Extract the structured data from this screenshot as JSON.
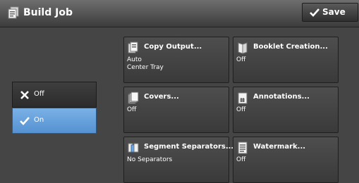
{
  "header": {
    "title": "Build Job",
    "save_label": "Save"
  },
  "toggle": {
    "off_label": "Off",
    "on_label": "On",
    "selected": "On"
  },
  "tiles": [
    {
      "title": "Copy Output...",
      "value": "Auto\nCenter Tray"
    },
    {
      "title": "Booklet Creation...",
      "value": "Off"
    },
    {
      "title": "Covers...",
      "value": "Off"
    },
    {
      "title": "Annotations...",
      "value": "Off"
    },
    {
      "title": "Segment Separators...",
      "value": "No Separators"
    },
    {
      "title": "Watermark...",
      "value": "Off"
    }
  ],
  "colors": {
    "selected": "#6aa6e2",
    "background": "#454545",
    "header": "#4e4e4e"
  }
}
